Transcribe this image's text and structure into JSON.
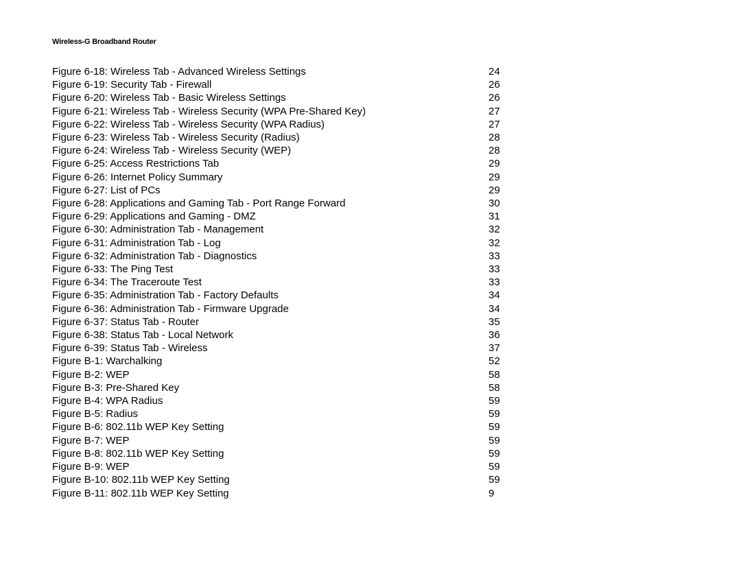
{
  "header": {
    "title": "Wireless-G Broadband Router"
  },
  "toc": {
    "entries": [
      {
        "label": "Figure 6-18: Wireless Tab - Advanced Wireless Settings",
        "page": "24"
      },
      {
        "label": "Figure 6-19: Security Tab - Firewall",
        "page": "26"
      },
      {
        "label": "Figure 6-20: Wireless Tab - Basic Wireless Settings",
        "page": "26"
      },
      {
        "label": "Figure 6-21: Wireless Tab - Wireless Security (WPA Pre-Shared Key)",
        "page": "27"
      },
      {
        "label": "Figure 6-22: Wireless Tab - Wireless Security (WPA Radius)",
        "page": "27"
      },
      {
        "label": "Figure 6-23: Wireless Tab - Wireless Security (Radius)",
        "page": "28"
      },
      {
        "label": "Figure 6-24: Wireless Tab - Wireless Security (WEP)",
        "page": "28"
      },
      {
        "label": "Figure 6-25: Access Restrictions Tab",
        "page": "29"
      },
      {
        "label": "Figure 6-26: Internet Policy Summary",
        "page": "29"
      },
      {
        "label": "Figure 6-27: List of PCs",
        "page": "29"
      },
      {
        "label": "Figure 6-28: Applications and Gaming Tab - Port Range Forward",
        "page": "30"
      },
      {
        "label": "Figure 6-29: Applications and Gaming - DMZ",
        "page": "31"
      },
      {
        "label": "Figure 6-30: Administration Tab - Management",
        "page": "32"
      },
      {
        "label": "Figure 6-31: Administration Tab - Log",
        "page": "32"
      },
      {
        "label": "Figure 6-32: Administration Tab - Diagnostics",
        "page": "33"
      },
      {
        "label": "Figure 6-33: The Ping Test",
        "page": "33"
      },
      {
        "label": "Figure 6-34: The Traceroute Test",
        "page": "33"
      },
      {
        "label": "Figure 6-35: Administration Tab - Factory Defaults",
        "page": "34"
      },
      {
        "label": "Figure 6-36: Administration Tab - Firmware Upgrade",
        "page": "34"
      },
      {
        "label": "Figure 6-37: Status Tab - Router",
        "page": "35"
      },
      {
        "label": "Figure 6-38: Status Tab - Local Network",
        "page": "36"
      },
      {
        "label": "Figure 6-39: Status Tab - Wireless",
        "page": "37"
      },
      {
        "label": "Figure B-1: Warchalking",
        "page": "52"
      },
      {
        "label": "Figure B-2: WEP",
        "page": "58"
      },
      {
        "label": "Figure B-3: Pre-Shared Key",
        "page": "58"
      },
      {
        "label": "Figure B-4: WPA Radius",
        "page": "59"
      },
      {
        "label": "Figure B-5: Radius",
        "page": "59"
      },
      {
        "label": "Figure B-6: 802.11b WEP Key Setting",
        "page": "59"
      },
      {
        "label": "Figure B-7: WEP",
        "page": "59"
      },
      {
        "label": "Figure B-8: 802.11b WEP Key Setting",
        "page": "59"
      },
      {
        "label": "Figure B-9: WEP",
        "page": "59"
      },
      {
        "label": "Figure B-10: 802.11b WEP Key Setting",
        "page": "59"
      },
      {
        "label": "Figure B-11: 802.11b WEP Key Setting",
        "page": "9"
      }
    ]
  }
}
